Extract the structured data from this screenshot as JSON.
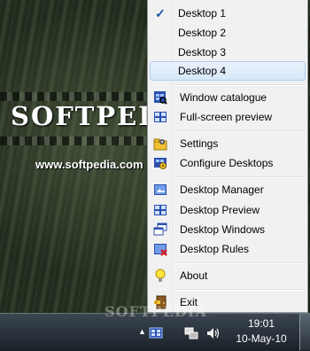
{
  "wallpaper": {
    "watermark_title": "SOFTPEDIA",
    "watermark_url": "www.softpedia.com",
    "taskbar_watermark": "SOFTPEDIA"
  },
  "menu": {
    "desktops": [
      {
        "label": "Desktop 1",
        "checked": true
      },
      {
        "label": "Desktop 2",
        "checked": false
      },
      {
        "label": "Desktop 3",
        "checked": false
      },
      {
        "label": "Desktop 4",
        "checked": false,
        "hovered": true
      }
    ],
    "window_catalogue": {
      "label": "Window catalogue",
      "icon": "window-catalogue-icon"
    },
    "fullscreen_preview": {
      "label": "Full-screen preview",
      "icon": "fullscreen-preview-icon"
    },
    "settings": {
      "label": "Settings",
      "icon": "settings-folder-icon"
    },
    "configure_desktops": {
      "label": "Configure Desktops",
      "icon": "configure-desktops-icon"
    },
    "desktop_manager": {
      "label": "Desktop Manager",
      "icon": "desktop-manager-icon"
    },
    "desktop_preview": {
      "label": "Desktop Preview",
      "icon": "desktop-preview-icon"
    },
    "desktop_windows": {
      "label": "Desktop Windows",
      "icon": "desktop-windows-icon"
    },
    "desktop_rules": {
      "label": "Desktop Rules",
      "icon": "desktop-rules-icon"
    },
    "about": {
      "label": "About",
      "icon": "lightbulb-icon"
    },
    "exit": {
      "label": "Exit",
      "icon": "exit-door-icon"
    }
  },
  "taskbar": {
    "time": "19:01",
    "date": "10-May-10",
    "tray_up_arrow": "▲"
  },
  "colors": {
    "menu_bg": "#f1f1f1",
    "hover_bg": "#d7e7f8",
    "check": "#1c4fa3",
    "taskbar": "#1a2028"
  }
}
